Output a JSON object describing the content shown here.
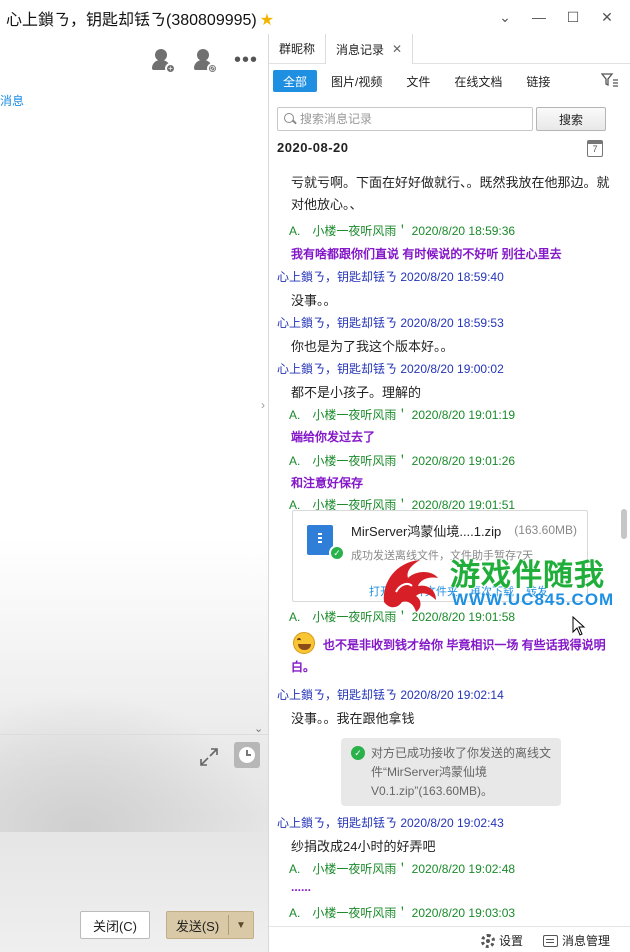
{
  "window": {
    "title": "心上鎖ㄋ，钥匙却铥ㄋ(380809995)",
    "star_icon": "star-icon",
    "buttons": [
      "chevron-down-icon",
      "minimize-icon",
      "maximize-icon",
      "close-icon"
    ]
  },
  "left": {
    "link_text": "消息",
    "close_label": "关闭(C)",
    "send_label": "发送(S)"
  },
  "tabs": [
    {
      "label": "群昵称"
    },
    {
      "label": "消息记录",
      "close": "✕"
    }
  ],
  "filters": [
    "全部",
    "图片/视频",
    "文件",
    "在线文档",
    "链接"
  ],
  "search": {
    "placeholder": "搜索消息记录",
    "button": "搜索"
  },
  "date_header": "2020-08-20",
  "calendar_day": "7",
  "messages": {
    "m0_text": "亏就亏啊。下面在好好做就行、。既然我放在他那边。就对他放心。、",
    "m1_header": "A.　小楼一夜听风雨＇ 2020/8/20 18:59:36",
    "m1_text": "我有啥都跟你们直说 有时候说的不好听 别往心里去",
    "m2_header": "心上鎖ㄋ，钥匙却铥ㄋ 2020/8/20 18:59:40",
    "m2_text": "没事。。",
    "m3_header": "心上鎖ㄋ，钥匙却铥ㄋ 2020/8/20 18:59:53",
    "m3_text": "你也是为了我这个版本好。。",
    "m4_header": "心上鎖ㄋ，钥匙却铥ㄋ 2020/8/20 19:00:02",
    "m4_text": "都不是小孩子。理解的",
    "m5_header": "A.　小楼一夜听风雨＇ 2020/8/20 19:01:19",
    "m5_text": "端给你发过去了",
    "m6_header": "A.　小楼一夜听风雨＇ 2020/8/20 19:01:26",
    "m6_text": "和注意好保存",
    "m7_header": "A.　小楼一夜听风雨＇ 2020/8/20 19:01:51",
    "file_name": "MirServer鸿蒙仙境....1.zip",
    "file_size": "(163.60MB)",
    "file_status": "成功发送离线文件，文件助手暂存7天",
    "file_actions": [
      "打开",
      "打开文件夹",
      "再次下载",
      "转发"
    ],
    "m8_header": "A.　小楼一夜听风雨＇ 2020/8/20 19:01:58",
    "m8_text": "也不是非收到钱才给你 毕竟相识一场 有些话我得说明白。",
    "m9_header": "心上鎖ㄋ，钥匙却铥ㄋ 2020/8/20 19:02:14",
    "m9_text": "没事。。我在跟他拿钱",
    "sys_text": "对方已成功接收了你发送的离线文件“MirServer鸿蒙仙境V0.1.zip”(163.60MB)。",
    "m10_header": "心上鎖ㄋ，钥匙却铥ㄋ 2020/8/20 19:02:43",
    "m10_text": "纱捐改成24小时的好弄吧",
    "m11_header": "A.　小楼一夜听风雨＇ 2020/8/20 19:02:48",
    "m11_text": "......",
    "m12_header": "A.　小楼一夜听风雨＇ 2020/8/20 19:03:03"
  },
  "bottom": {
    "settings": "设置",
    "manage": "消息管理"
  },
  "watermark": {
    "cn": "游戏伴随我",
    "url": "WWW.UC845.COM"
  },
  "colors": {
    "accent": "#1e8fe1",
    "self_name": "#2434b8",
    "other_name": "#1a8a2a",
    "highlight_text": "#8418c9",
    "send_button": "#d9c9a6"
  }
}
